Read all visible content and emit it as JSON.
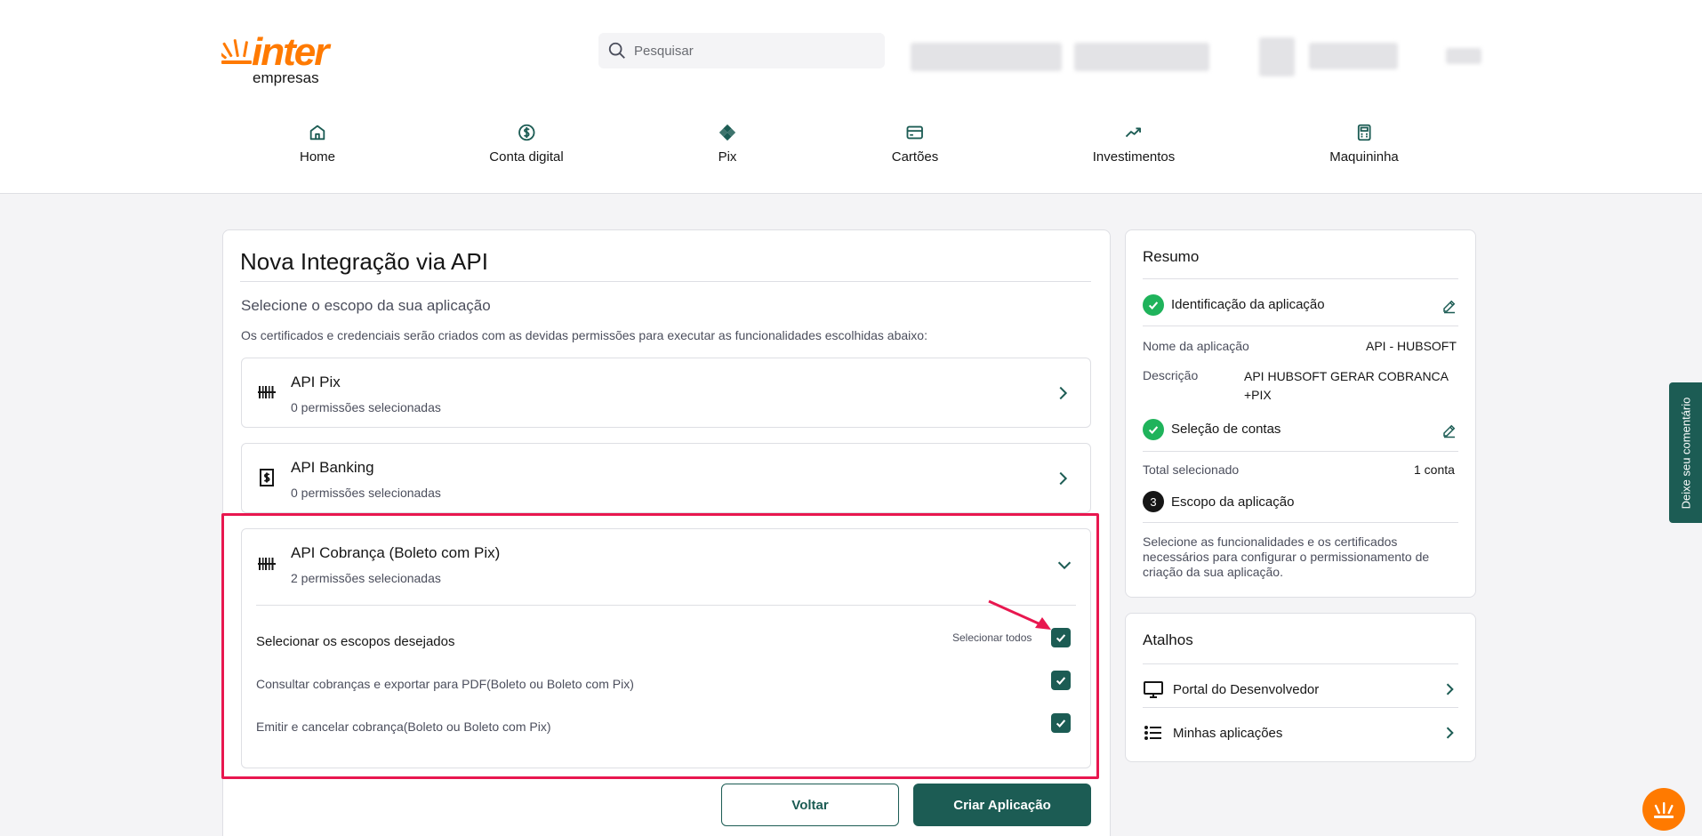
{
  "header": {
    "logo_word": "inter",
    "logo_sub": "empresas",
    "search_placeholder": "Pesquisar",
    "brand_color": "#ff7a00",
    "accent_color": "#1c5c54"
  },
  "nav": [
    {
      "label": "Home",
      "icon": "home-icon"
    },
    {
      "label": "Conta digital",
      "icon": "dollar-circle-icon"
    },
    {
      "label": "Pix",
      "icon": "pix-icon"
    },
    {
      "label": "Cartões",
      "icon": "card-icon"
    },
    {
      "label": "Investimentos",
      "icon": "trending-up-icon"
    },
    {
      "label": "Maquininha",
      "icon": "pos-machine-icon"
    }
  ],
  "main": {
    "title": "Nova Integração via API",
    "subtitle": "Selecione o escopo da sua aplicação",
    "description": "Os certificados e credenciais serão criados com as devidas permissões para executar as funcionalidades escolhidas abaixo:",
    "apis": [
      {
        "name": "API Pix",
        "permissions": "0 permissões selecionadas"
      },
      {
        "name": "API Banking",
        "permissions": "0 permissões selecionadas"
      },
      {
        "name": "API Cobrança (Boleto com Pix)",
        "permissions": "2 permissões selecionadas"
      }
    ],
    "scopes": {
      "heading": "Selecionar os escopos desejados",
      "select_all": "Selecionar todos",
      "select_all_checked": true,
      "items": [
        {
          "label": "Consultar cobranças e exportar para PDF(Boleto ou Boleto com Pix)",
          "checked": true
        },
        {
          "label": "Emitir e cancelar cobrança(Boleto ou Boleto com Pix)",
          "checked": true
        }
      ]
    },
    "buttons": {
      "back": "Voltar",
      "create": "Criar Aplicação"
    }
  },
  "resumo": {
    "title": "Resumo",
    "step1": "Identificação da aplicação",
    "app_name_key": "Nome da aplicação",
    "app_name_value": "API - HUBSOFT",
    "desc_key": "Descrição",
    "desc_value_line1": "API HUBSOFT GERAR COBRANCA",
    "desc_value_line2": "+PIX",
    "step2": "Seleção de contas",
    "total_key": "Total selecionado",
    "total_value": "1 conta",
    "step3_number": "3",
    "step3": "Escopo da aplicação",
    "step3_desc": "Selecione as funcionalidades e os certificados necessários para configurar o permissionamento de criação da sua aplicação."
  },
  "atalhos": {
    "title": "Atalhos",
    "items": [
      {
        "label": "Portal do Desenvolvedor",
        "icon": "monitor-icon"
      },
      {
        "label": "Minhas aplicações",
        "icon": "list-icon"
      }
    ]
  },
  "feedback": "Deixe seu comentário"
}
